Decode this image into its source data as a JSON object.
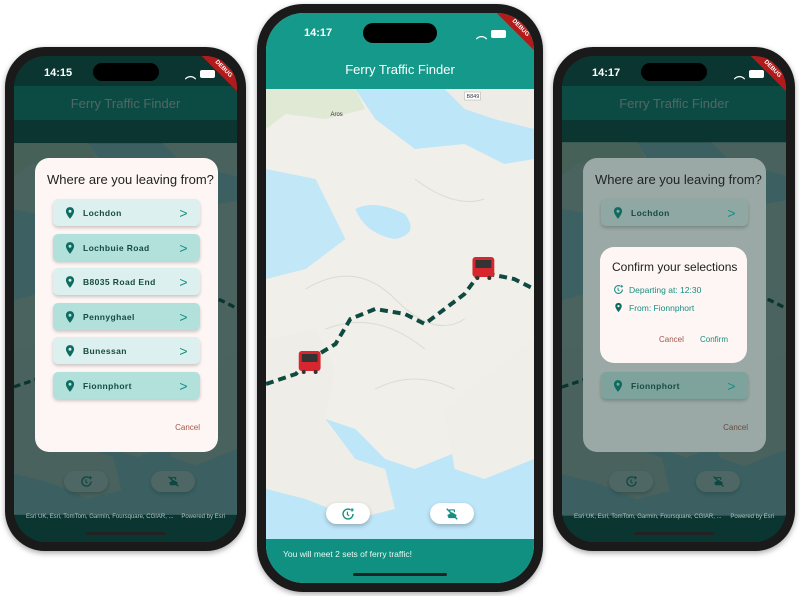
{
  "app": {
    "title": "Ferry Traffic Finder",
    "debug_badge": "DEBUG"
  },
  "colors": {
    "primary": "#14998a",
    "dark_overlay": "#0b4d45",
    "ferry_red": "#d8262e",
    "route": "#0e4a40",
    "water": "#bde6f8"
  },
  "phones": [
    {
      "time": "14:15"
    },
    {
      "time": "14:17"
    },
    {
      "time": "14:17"
    }
  ],
  "map": {
    "labels": [
      "Aros",
      "B849"
    ],
    "attribution": "Esri UK, Esri, TomTom, Garmin, Foursquare, CGIAR, ...",
    "powered_by": "Powered by Esri"
  },
  "location_dialog": {
    "title": "Where are you leaving from?",
    "items": [
      {
        "label": "Lochdon"
      },
      {
        "label": "Lochbuie Road"
      },
      {
        "label": "B8035 Road End"
      },
      {
        "label": "Pennyghael"
      },
      {
        "label": "Bunessan"
      },
      {
        "label": "Fionnphort"
      }
    ],
    "cancel": "Cancel"
  },
  "confirm_dialog": {
    "title": "Confirm your selections",
    "departing": "Departing at: 12:30",
    "from": "From: Fionnphort",
    "cancel": "Cancel",
    "confirm": "Confirm"
  },
  "result_bar": {
    "message": "You will meet 2 sets of ferry traffic!"
  },
  "fab_icons": [
    "clock-plus-icon",
    "ferry-off-icon"
  ]
}
